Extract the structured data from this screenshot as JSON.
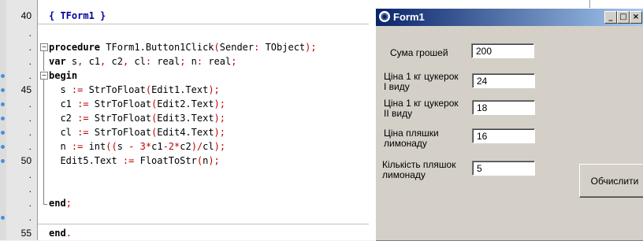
{
  "editor": {
    "line_numbers": [
      "40",
      ".",
      ".",
      ".",
      ".",
      "45",
      ".",
      ".",
      ".",
      ".",
      "50",
      ".",
      ".",
      ".",
      ".",
      "55"
    ],
    "lines": [
      [
        {
          "t": "{ TForm1 }",
          "c": "cm"
        }
      ],
      [],
      [
        {
          "t": "procedure",
          "c": "kw"
        },
        {
          "t": " TForm1.Button1Click",
          "c": ""
        },
        {
          "t": "(",
          "c": "op"
        },
        {
          "t": "Sender",
          "c": ""
        },
        {
          "t": ": ",
          "c": "op"
        },
        {
          "t": "TObject",
          "c": ""
        },
        {
          "t": ");",
          "c": "op"
        }
      ],
      [
        {
          "t": "var",
          "c": "kw"
        },
        {
          "t": " s",
          "c": ""
        },
        {
          "t": ", ",
          "c": "op"
        },
        {
          "t": "c1",
          "c": ""
        },
        {
          "t": ", ",
          "c": "op"
        },
        {
          "t": "c2",
          "c": ""
        },
        {
          "t": ", ",
          "c": "op"
        },
        {
          "t": "cl",
          "c": ""
        },
        {
          "t": ": ",
          "c": "op"
        },
        {
          "t": "real",
          "c": ""
        },
        {
          "t": "; ",
          "c": "op"
        },
        {
          "t": "n",
          "c": ""
        },
        {
          "t": ": ",
          "c": "op"
        },
        {
          "t": "real",
          "c": ""
        },
        {
          "t": ";",
          "c": "op"
        }
      ],
      [
        {
          "t": "begin",
          "c": "kw"
        }
      ],
      [
        {
          "t": "  s ",
          "c": ""
        },
        {
          "t": ":=",
          "c": "op"
        },
        {
          "t": " StrToFloat",
          "c": ""
        },
        {
          "t": "(",
          "c": "op"
        },
        {
          "t": "Edit1.Text",
          "c": ""
        },
        {
          "t": ");",
          "c": "op"
        }
      ],
      [
        {
          "t": "  c1 ",
          "c": ""
        },
        {
          "t": ":=",
          "c": "op"
        },
        {
          "t": " StrToFloat",
          "c": ""
        },
        {
          "t": "(",
          "c": "op"
        },
        {
          "t": "Edit2.Text",
          "c": ""
        },
        {
          "t": ");",
          "c": "op"
        }
      ],
      [
        {
          "t": "  c2 ",
          "c": ""
        },
        {
          "t": ":=",
          "c": "op"
        },
        {
          "t": " StrToFloat",
          "c": ""
        },
        {
          "t": "(",
          "c": "op"
        },
        {
          "t": "Edit3.Text",
          "c": ""
        },
        {
          "t": ");",
          "c": "op"
        }
      ],
      [
        {
          "t": "  cl ",
          "c": ""
        },
        {
          "t": ":=",
          "c": "op"
        },
        {
          "t": " StrToFloat",
          "c": ""
        },
        {
          "t": "(",
          "c": "op"
        },
        {
          "t": "Edit4.Text",
          "c": ""
        },
        {
          "t": ");",
          "c": "op"
        }
      ],
      [
        {
          "t": "  n ",
          "c": ""
        },
        {
          "t": ":=",
          "c": "op"
        },
        {
          "t": " int",
          "c": ""
        },
        {
          "t": "((",
          "c": "op"
        },
        {
          "t": "s ",
          "c": ""
        },
        {
          "t": "-",
          "c": "op"
        },
        {
          "t": " ",
          "c": ""
        },
        {
          "t": "3",
          "c": "num"
        },
        {
          "t": "*",
          "c": "op"
        },
        {
          "t": "c1",
          "c": ""
        },
        {
          "t": "-",
          "c": "op"
        },
        {
          "t": "2",
          "c": "num"
        },
        {
          "t": "*",
          "c": "op"
        },
        {
          "t": "c2",
          "c": ""
        },
        {
          "t": ")/",
          "c": "op"
        },
        {
          "t": "cl",
          "c": ""
        },
        {
          "t": ");",
          "c": "op"
        }
      ],
      [
        {
          "t": "  Edit5.Text ",
          "c": ""
        },
        {
          "t": ":=",
          "c": "op"
        },
        {
          "t": " FloatToStr",
          "c": ""
        },
        {
          "t": "(",
          "c": "op"
        },
        {
          "t": "n",
          "c": ""
        },
        {
          "t": ");",
          "c": "op"
        }
      ],
      [],
      [],
      [
        {
          "t": "end",
          "c": "kw"
        },
        {
          "t": ";",
          "c": "op"
        }
      ],
      [],
      [
        {
          "t": "end",
          "c": "kw"
        },
        {
          "t": ".",
          "c": "op"
        }
      ]
    ],
    "colors": {
      "keyword": "#000000",
      "operator": "#c00000",
      "comment": "#0000a0",
      "breakpoint": "#4a90d9"
    }
  },
  "form": {
    "title": "Form1",
    "title_icon": "delphi-form-icon",
    "minimize": "_",
    "maximize": "□",
    "close": "×",
    "fields": [
      {
        "label": "Сума грошей",
        "value": "200"
      },
      {
        "label": "Ціна 1 кг цукерок І виду",
        "value": "24"
      },
      {
        "label": "Ціна 1 кг цукерок ІІ виду",
        "value": "18"
      },
      {
        "label": "Ціна пляшки лимонаду",
        "value": "16"
      },
      {
        "label": "Кількість пляшок лимонаду",
        "value": "5"
      }
    ],
    "button_label": "Обчислити",
    "colors": {
      "title_start": "#0a246a",
      "title_end": "#a6caf0",
      "face": "#d4d0c8"
    }
  }
}
